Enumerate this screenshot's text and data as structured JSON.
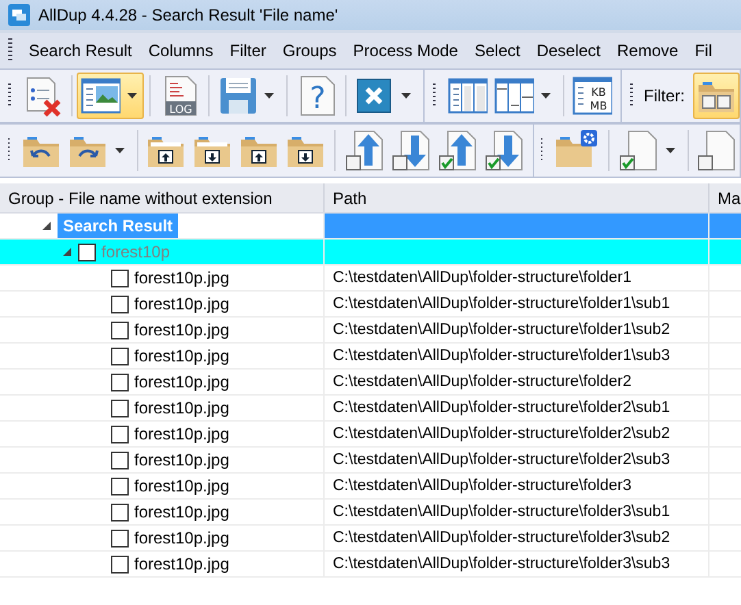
{
  "window": {
    "title": "AllDup 4.4.28 - Search Result 'File name'"
  },
  "menu": [
    "Search Result",
    "Columns",
    "Filter",
    "Groups",
    "Process Mode",
    "Select",
    "Deselect",
    "Remove",
    "Fil"
  ],
  "toolbar_1": [
    {
      "kind": "clear-list",
      "pressed": false,
      "dropdown": false
    },
    {
      "kind": "separator"
    },
    {
      "kind": "view",
      "pressed": true,
      "dropdown": true
    },
    {
      "kind": "separator"
    },
    {
      "kind": "log",
      "pressed": false,
      "dropdown": false,
      "label": "LOG"
    },
    {
      "kind": "separator"
    },
    {
      "kind": "save",
      "pressed": false,
      "dropdown": true
    },
    {
      "kind": "separator"
    },
    {
      "kind": "help",
      "pressed": false,
      "dropdown": false,
      "label": "?"
    },
    {
      "kind": "separator"
    },
    {
      "kind": "close",
      "pressed": false,
      "dropdown": true
    },
    {
      "kind": "group-separator"
    },
    {
      "kind": "columns",
      "pressed": false,
      "dropdown": false
    },
    {
      "kind": "column-width",
      "pressed": false,
      "dropdown": true
    },
    {
      "kind": "separator"
    },
    {
      "kind": "units",
      "pressed": false,
      "dropdown": false,
      "label": "KB",
      "label2": "MB"
    },
    {
      "kind": "group-separator"
    },
    {
      "kind": "filter-label",
      "label": "Filter:"
    },
    {
      "kind": "filter-folder",
      "pressed": true,
      "dropdown": false
    }
  ],
  "toolbar_2": [
    {
      "kind": "folder-back",
      "dropdown": false
    },
    {
      "kind": "folder-forward",
      "dropdown": true
    },
    {
      "kind": "separator"
    },
    {
      "kind": "folder-open-up",
      "dropdown": false
    },
    {
      "kind": "folder-open-down",
      "dropdown": false
    },
    {
      "kind": "folder-up",
      "dropdown": false
    },
    {
      "kind": "folder-down",
      "dropdown": false
    },
    {
      "kind": "separator"
    },
    {
      "kind": "file-up",
      "dropdown": false,
      "checked": false
    },
    {
      "kind": "file-down",
      "dropdown": false,
      "checked": false
    },
    {
      "kind": "file-up",
      "dropdown": false,
      "checked": true
    },
    {
      "kind": "file-down",
      "dropdown": false,
      "checked": true
    },
    {
      "kind": "group-separator"
    },
    {
      "kind": "folder-settings",
      "dropdown": false
    },
    {
      "kind": "separator"
    },
    {
      "kind": "file-check",
      "dropdown": true,
      "checked": true
    },
    {
      "kind": "separator"
    },
    {
      "kind": "file-check",
      "dropdown": false,
      "checked": false
    }
  ],
  "table": {
    "columns": [
      "Group - File name without extension",
      "Path",
      "Ma"
    ],
    "root": {
      "label": "Search Result",
      "expanded": true,
      "selected": true,
      "groups": [
        {
          "name": "forest10p",
          "expanded": true,
          "checked": false,
          "highlighted": true,
          "files": [
            {
              "name": "forest10p.jpg",
              "path": "C:\\testdaten\\AllDup\\folder-structure\\folder1",
              "checked": false
            },
            {
              "name": "forest10p.jpg",
              "path": "C:\\testdaten\\AllDup\\folder-structure\\folder1\\sub1",
              "checked": false
            },
            {
              "name": "forest10p.jpg",
              "path": "C:\\testdaten\\AllDup\\folder-structure\\folder1\\sub2",
              "checked": false
            },
            {
              "name": "forest10p.jpg",
              "path": "C:\\testdaten\\AllDup\\folder-structure\\folder1\\sub3",
              "checked": false
            },
            {
              "name": "forest10p.jpg",
              "path": "C:\\testdaten\\AllDup\\folder-structure\\folder2",
              "checked": false
            },
            {
              "name": "forest10p.jpg",
              "path": "C:\\testdaten\\AllDup\\folder-structure\\folder2\\sub1",
              "checked": false
            },
            {
              "name": "forest10p.jpg",
              "path": "C:\\testdaten\\AllDup\\folder-structure\\folder2\\sub2",
              "checked": false
            },
            {
              "name": "forest10p.jpg",
              "path": "C:\\testdaten\\AllDup\\folder-structure\\folder2\\sub3",
              "checked": false
            },
            {
              "name": "forest10p.jpg",
              "path": "C:\\testdaten\\AllDup\\folder-structure\\folder3",
              "checked": false
            },
            {
              "name": "forest10p.jpg",
              "path": "C:\\testdaten\\AllDup\\folder-structure\\folder3\\sub1",
              "checked": false
            },
            {
              "name": "forest10p.jpg",
              "path": "C:\\testdaten\\AllDup\\folder-structure\\folder3\\sub2",
              "checked": false
            },
            {
              "name": "forest10p.jpg",
              "path": "C:\\testdaten\\AllDup\\folder-structure\\folder3\\sub3",
              "checked": false
            }
          ]
        }
      ]
    }
  }
}
